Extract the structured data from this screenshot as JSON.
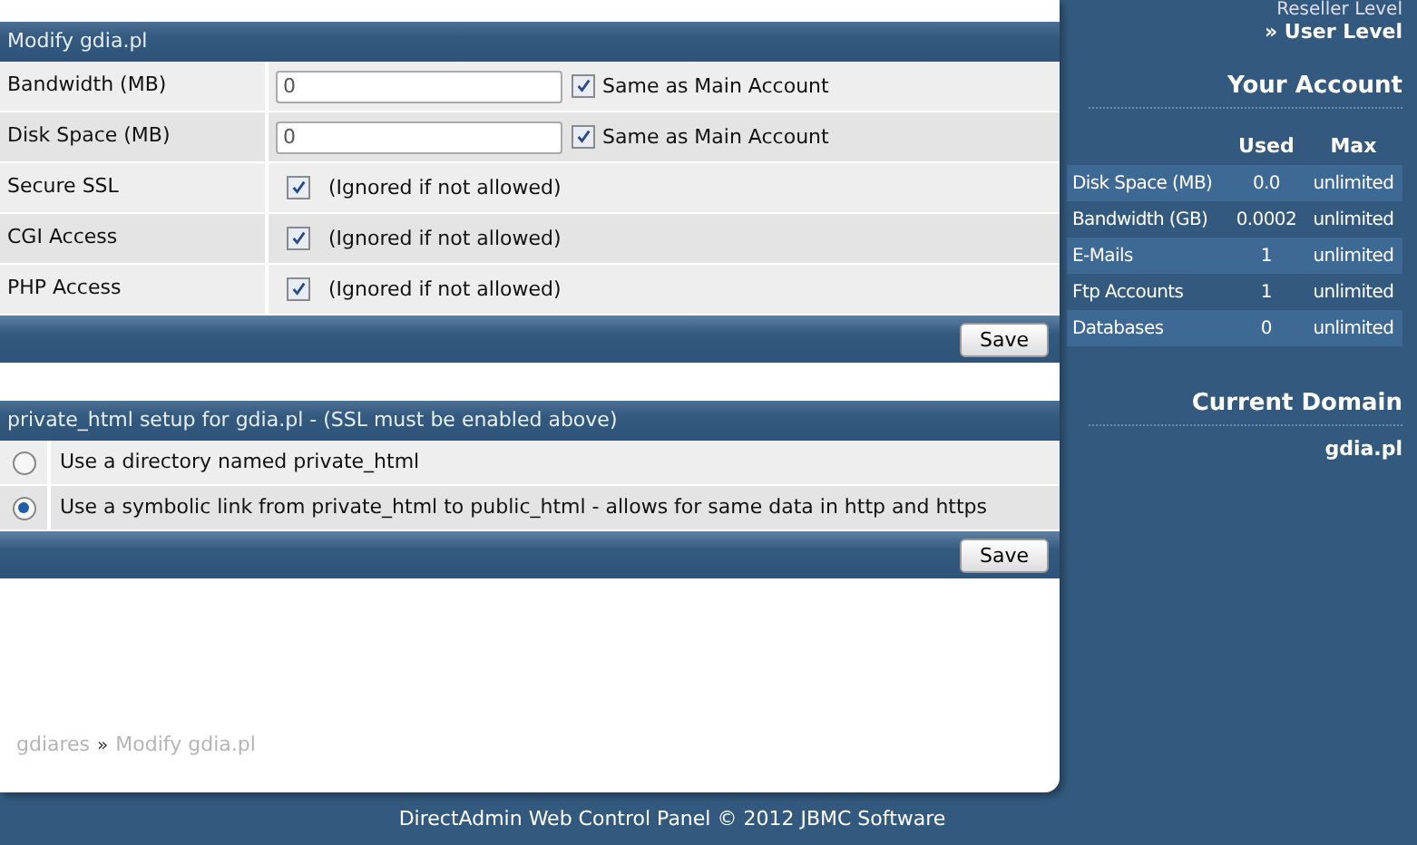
{
  "modify": {
    "title": "Modify gdia.pl",
    "rows": [
      {
        "kind": "input",
        "label": "Bandwidth (MB)",
        "value": "0",
        "checked": true,
        "note": "Same as Main Account"
      },
      {
        "kind": "input",
        "label": "Disk Space (MB)",
        "value": "0",
        "checked": true,
        "note": "Same as Main Account"
      },
      {
        "kind": "check",
        "label": "Secure SSL",
        "checked": true,
        "note": "(Ignored if not allowed)"
      },
      {
        "kind": "check",
        "label": "CGI Access",
        "checked": true,
        "note": "(Ignored if not allowed)"
      },
      {
        "kind": "check",
        "label": "PHP Access",
        "checked": true,
        "note": "(Ignored if not allowed)"
      }
    ],
    "button": "Save"
  },
  "private_html": {
    "title": "private_html setup for gdia.pl - (SSL must be enabled above)",
    "options": [
      {
        "label": "Use a directory named private_html",
        "selected": false
      },
      {
        "label": "Use a symbolic link from private_html to public_html - allows for same data in http and https",
        "selected": true
      }
    ],
    "button": "Save"
  },
  "breadcrumb": {
    "items": [
      "gdiares",
      "Modify gdia.pl"
    ],
    "separator": "»"
  },
  "sidebar": {
    "levels": [
      {
        "label": "Reseller Level",
        "selected": false
      },
      {
        "label": "» User Level",
        "selected": true
      }
    ],
    "account": {
      "title": "Your Account",
      "columns": [
        "Used",
        "Max"
      ],
      "rows": [
        {
          "name": "Disk Space (MB)",
          "used": "0.0",
          "max": "unlimited"
        },
        {
          "name": "Bandwidth (GB)",
          "used": "0.0002",
          "max": "unlimited"
        },
        {
          "name": "E-Mails",
          "used": "1",
          "max": "unlimited"
        },
        {
          "name": "Ftp Accounts",
          "used": "1",
          "max": "unlimited"
        },
        {
          "name": "Databases",
          "used": "0",
          "max": "unlimited"
        }
      ]
    },
    "domain": {
      "title": "Current Domain",
      "value": "gdia.pl"
    }
  },
  "footer": "DirectAdmin Web Control Panel © 2012 JBMC Software"
}
